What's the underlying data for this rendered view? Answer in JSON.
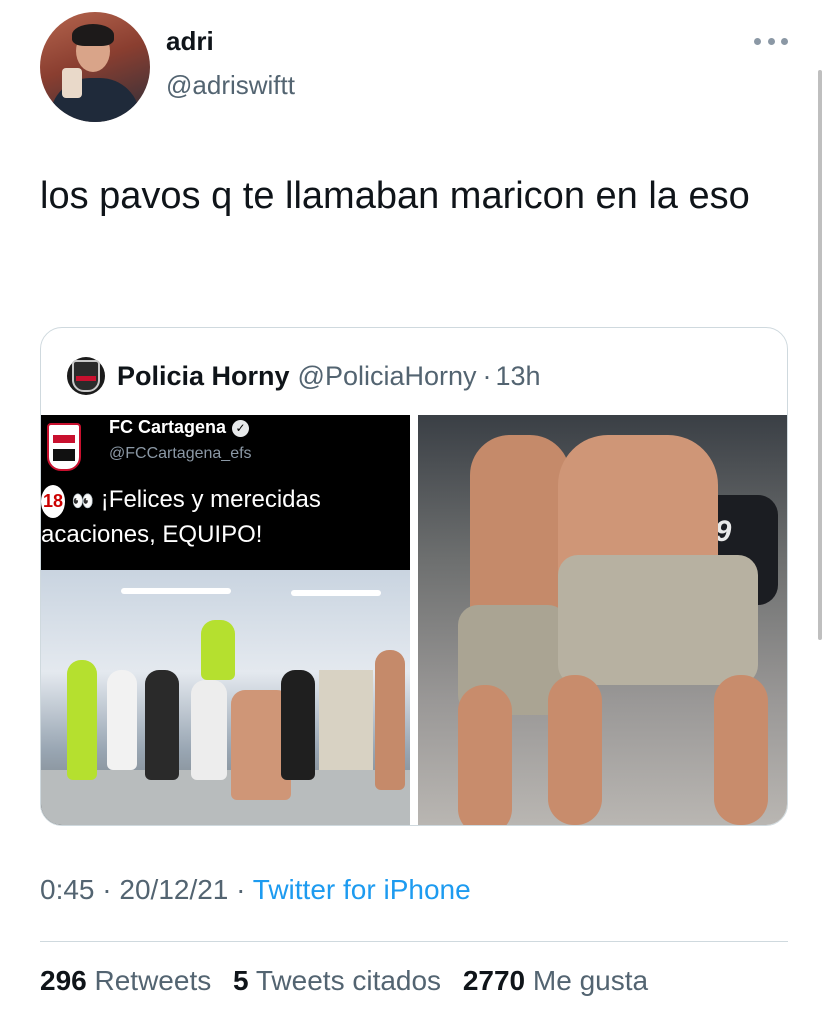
{
  "tweet": {
    "author_name": "adri",
    "author_handle": "@adriswiftt",
    "text": "los pavos q te llamaban maricon en la eso",
    "more_icon": "ellipsis-icon"
  },
  "quoted": {
    "author_name": "Policia Horny",
    "author_handle": "@PoliciaHorny",
    "separator": "·",
    "time": "13h",
    "left_image": {
      "account_name": "FC Cartagena",
      "account_handle": "@FCCartagena_efs",
      "verified_mark": "✓",
      "badge_text": "18",
      "eyes_emoji": "👀",
      "line1": "¡Felices y merecidas",
      "line2": "acaciones, EQUIPO!"
    },
    "right_image": {
      "shirt_number": "19"
    }
  },
  "meta": {
    "time": "0:45",
    "sep1": "·",
    "date": "20/12/21",
    "sep2": "·",
    "source": "Twitter for iPhone"
  },
  "stats": {
    "retweets_count": "296",
    "retweets_label": "Retweets",
    "quotes_count": "5",
    "quotes_label": "Tweets citados",
    "likes_count": "2770",
    "likes_label": "Me gusta"
  },
  "colors": {
    "link": "#1d9bf0",
    "secondary_text": "#536471",
    "border": "#cfd9de"
  }
}
